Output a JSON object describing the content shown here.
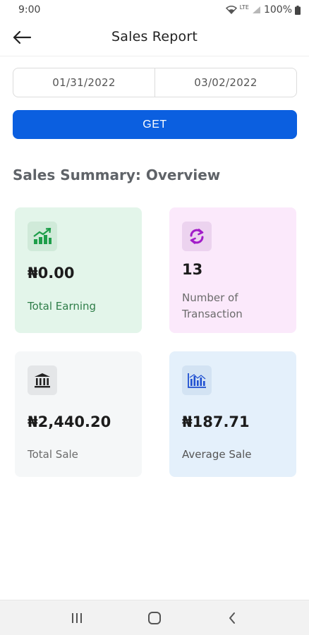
{
  "status_bar": {
    "time": "9:00",
    "network": "LTE",
    "battery": "100%"
  },
  "app_bar": {
    "title": "Sales Report",
    "back_icon": "arrow-left-icon"
  },
  "date_range": {
    "start_date": "01/31/2022",
    "end_date": "03/02/2022"
  },
  "get_button": {
    "label": "GET",
    "color": "#0b5fe0"
  },
  "summary": {
    "title": "Sales Summary: Overview",
    "cards": [
      {
        "key": "earning",
        "icon": "growth-chart-icon",
        "value": "₦0.00",
        "label": "Total Earning",
        "bg": "#e3f5ea",
        "accent": "#1e9e4a"
      },
      {
        "key": "transaction",
        "icon": "refresh-cycle-icon",
        "value": "13",
        "label": "Number of Transaction",
        "bg": "#fbe9fb",
        "accent": "#a21cc9"
      },
      {
        "key": "total_sale",
        "icon": "bank-icon",
        "value": "₦2,440.20",
        "label": "Total Sale",
        "bg": "#f5f7f8",
        "accent": "#222222"
      },
      {
        "key": "average_sale",
        "icon": "bar-chart-icon",
        "value": "₦187.71",
        "label": "Average Sale",
        "bg": "#e4f0fb",
        "accent": "#1f4fd1"
      }
    ]
  },
  "nav_bar": {
    "items": [
      "recent-apps-icon",
      "home-icon",
      "back-icon"
    ]
  }
}
